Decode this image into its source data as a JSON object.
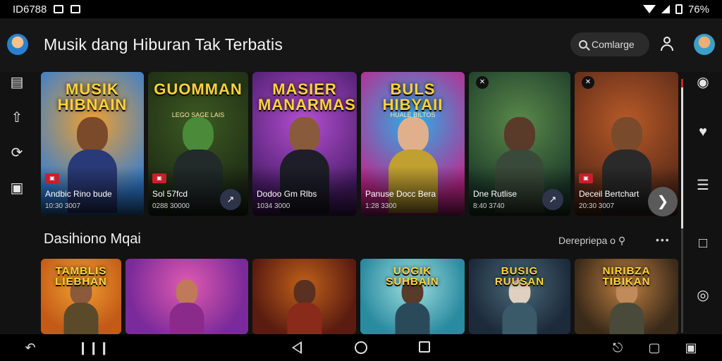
{
  "status_bar": {
    "left_text": "ID6788",
    "battery": "76%"
  },
  "header": {
    "title": "Musik dang Hiburan Tak Terbatis",
    "search": {
      "label": "Comlarge"
    }
  },
  "row1": [
    {
      "logo": "MUSIK\nHIBNAIN",
      "name": "Andbic Rino bude",
      "meta": "10:30 3007",
      "colors": [
        "#2e7dd7",
        "#f0a030"
      ],
      "skin": "#7b4a2a",
      "cloth": "#2a3a78",
      "badge": true
    },
    {
      "logo": "GUOMMAN",
      "sub": "LEGO SAGE LAIS",
      "name": "Sol 57fcd",
      "meta": "0288 30000",
      "colors": [
        "#1c2a14",
        "#3d5a22"
      ],
      "skin": "#4a8a38",
      "cloth": "#222a2a",
      "badge": true,
      "play": true
    },
    {
      "logo": "MASIER\nMANARMAS",
      "name": "Dodoo Gm Rlbs",
      "meta": "1034 3000",
      "colors": [
        "#4a1c6a",
        "#b34fd0"
      ],
      "skin": "#8a5a3c",
      "cloth": "#1e1e2a"
    },
    {
      "logo": "BULS\nHIBYAII",
      "sub": "HUALE BILTOS",
      "name": "Panuse Docc Bera",
      "meta": "1:28 3300",
      "colors": [
        "#c2248a",
        "#2ab0e8"
      ],
      "skin": "#e0b08c",
      "cloth": "#c0a030"
    },
    {
      "logo": "",
      "name": "Dne Rutlise",
      "meta": "8:40 3740",
      "colors": [
        "#1c3a2a",
        "#5a8a4a"
      ],
      "skin": "#5a3a28",
      "cloth": "#3a4a3a",
      "topicon": true,
      "play": true
    },
    {
      "logo": "",
      "name": "Deceil Bertchart",
      "meta": "20:30 3007",
      "colors": [
        "#5a2a18",
        "#b85a28"
      ],
      "skin": "#7a4a2c",
      "cloth": "#2a2a2a",
      "topicon": true,
      "badge": true
    }
  ],
  "section": {
    "title": "Dasihiono Mqai",
    "link": "Derepriepa o",
    "more": "•••"
  },
  "row2": [
    {
      "logo": "TAMBLIS\nLIEBHAN",
      "colors": [
        "#c25a18",
        "#f0a030"
      ],
      "skin": "#8a5a3a",
      "cloth": "#5a4a2a"
    },
    {
      "logo": "",
      "colors": [
        "#7a2a9a",
        "#e05ab0"
      ],
      "skin": "#c07a5a",
      "cloth": "#8a2a8a"
    },
    {
      "logo": "",
      "colors": [
        "#5a1c10",
        "#c0601a"
      ],
      "skin": "#5a3020",
      "cloth": "#8a2a1a"
    },
    {
      "logo": "UOGIK\nSUHBAIN",
      "colors": [
        "#2a8aa0",
        "#a0e0e0"
      ],
      "skin": "#5a3a2a",
      "cloth": "#2a4a5a"
    },
    {
      "logo": "BUSIG\nRUUSAN",
      "colors": [
        "#1c2a3a",
        "#4a6a7a"
      ],
      "skin": "#e0d0c0",
      "cloth": "#3a5a6a"
    },
    {
      "logo": "NIRIBZA\nTIBIKAN",
      "colors": [
        "#3a2a1a",
        "#c08040"
      ],
      "skin": "#c08a5a",
      "cloth": "#4a4a3a"
    }
  ]
}
